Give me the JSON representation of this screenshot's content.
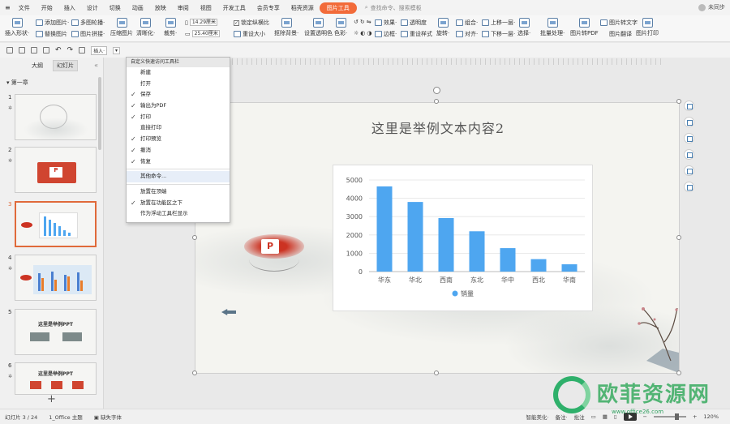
{
  "menubar": {
    "app_menu_label": "文件",
    "tabs": [
      "开始",
      "插入",
      "设计",
      "切换",
      "动画",
      "放映",
      "审阅",
      "视图",
      "开发工具",
      "会员专享",
      "稻壳资源"
    ],
    "active_tab": "图片工具",
    "search_placeholder": "查找命令、搜索模板",
    "user_status": "未同步"
  },
  "ribbon": {
    "insert_picture": "插入形状·",
    "add_picture": "添加图片·",
    "replace_picture": "替换图片",
    "multi_picture": "多图轮播·",
    "picture_stitch": "图片拼接·",
    "compress": "压缩图片",
    "clarity": "清晰化·",
    "crop": "裁剪·",
    "width_value": "14.29厘米",
    "height_value": "25.40厘米",
    "lock_ratio": "锁定纵横比",
    "reset_size": "重设大小",
    "cutout_bg": "抠除背景·",
    "set_transparent": "设置透明色",
    "color": "色彩·",
    "effects": "效果·",
    "border": "边框·",
    "transparency": "透明度",
    "reset_style": "重设样式",
    "rotate": "旋转·",
    "group": "组合·",
    "align": "对齐·",
    "bring_forward": "上移一层·",
    "send_backward": "下移一层·",
    "select": "选择·",
    "batch": "批量处理·",
    "to_pdf": "图片转PDF",
    "to_text": "图片转文字",
    "translate": "图片翻译",
    "print": "图片打印"
  },
  "quickbar": {
    "insert_label": "插入·"
  },
  "left_panel": {
    "tabs": [
      "大纲",
      "幻灯片"
    ],
    "active_tab": "幻灯片",
    "section": "第一章",
    "slides": [
      {
        "num": "1",
        "title": ""
      },
      {
        "num": "2",
        "title": ""
      },
      {
        "num": "3",
        "title": ""
      },
      {
        "num": "4",
        "title": ""
      },
      {
        "num": "5",
        "title": "这里是举例PPT"
      },
      {
        "num": "6",
        "title": "这里是举例PPT"
      }
    ],
    "add_slide": "+"
  },
  "dropdown": {
    "header": "自定义快速访问工具栏",
    "items": [
      {
        "label": "新建",
        "checked": false
      },
      {
        "label": "打开",
        "checked": false
      },
      {
        "label": "保存",
        "checked": true
      },
      {
        "label": "输出为PDF",
        "checked": true
      },
      {
        "label": "打印",
        "checked": true
      },
      {
        "label": "直接打印",
        "checked": false
      },
      {
        "label": "打印预览",
        "checked": true
      },
      {
        "label": "撤消",
        "checked": true
      },
      {
        "label": "恢复",
        "checked": true
      }
    ],
    "more_commands": "其他命令...",
    "position_items": [
      {
        "label": "放置在顶端",
        "checked": false
      },
      {
        "label": "放置在功能区之下",
        "checked": true
      },
      {
        "label": "作为浮动工具栏显示",
        "checked": false
      }
    ]
  },
  "slide": {
    "title": "这里是举例文本内容2",
    "ppt_logo_text": "P"
  },
  "chart_data": {
    "type": "bar",
    "categories": [
      "华东",
      "华北",
      "西南",
      "东北",
      "华中",
      "西北",
      "华南"
    ],
    "series": [
      {
        "name": "销量",
        "values": [
          4650,
          3800,
          2920,
          2200,
          1280,
          680,
          400
        ],
        "color": "#4ea6f0"
      }
    ],
    "ylim": [
      0,
      5000
    ],
    "yticks": [
      "0",
      "1000",
      "2000",
      "3000",
      "4000",
      "5000"
    ],
    "grid": true,
    "legend_position": "bottom"
  },
  "statusbar": {
    "slide_counter": "幻灯片 3 / 24",
    "theme": "1_Office 主题",
    "missing_font": "缺失字体",
    "smart_beautify": "智能美化·",
    "notes": "备注·",
    "comments": "批注",
    "zoom": "120%"
  },
  "watermark": {
    "text": "欧菲资源网",
    "url": "www.office26.com"
  }
}
